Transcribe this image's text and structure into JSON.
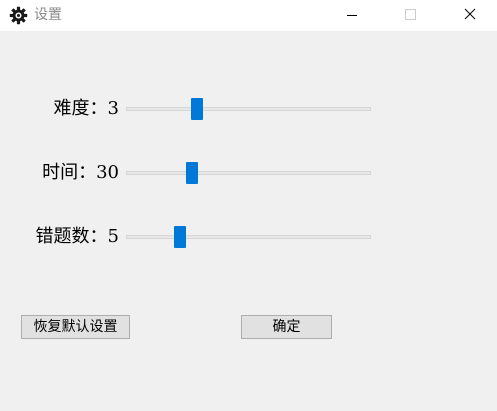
{
  "window": {
    "title": "设置",
    "icon": "gear-icon",
    "controls": [
      "minimize-icon",
      "maximize-icon",
      "close-icon"
    ]
  },
  "settings": [
    {
      "label": "难度：3",
      "value": 3,
      "fraction": 0.29
    },
    {
      "label": "时间：30",
      "value": 30,
      "fraction": 0.27
    },
    {
      "label": "错题数：5",
      "value": 5,
      "fraction": 0.22
    }
  ],
  "buttons": {
    "reset_label": "恢复默认设置",
    "ok_label": "确定"
  },
  "colors": {
    "accent": "#0078d7",
    "background": "#f0f0f0",
    "titlebar": "#ffffff"
  }
}
